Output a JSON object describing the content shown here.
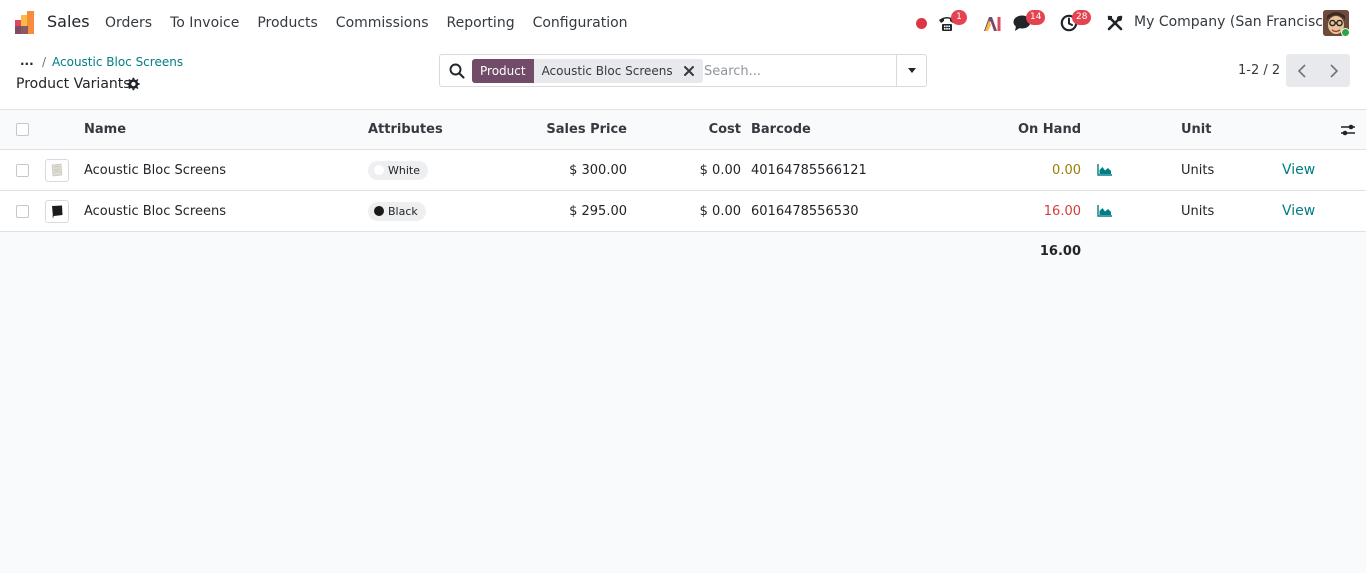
{
  "colors": {
    "brand": "#714b67",
    "link": "#017e84",
    "badge": "#e4434f",
    "stock_zero": "#9b7e08",
    "stock_positive": "#d23f3a"
  },
  "navbar": {
    "app_name": "Sales",
    "menu": [
      "Orders",
      "To Invoice",
      "Products",
      "Commissions",
      "Reporting",
      "Configuration"
    ],
    "badges": {
      "phone": "1",
      "messages": "14",
      "activities": "28"
    },
    "company": "My Company (San Francisco)",
    "icons": [
      "status-dot",
      "phone-icon",
      "ai-icon",
      "chat-icon",
      "clock-icon",
      "debug-tools-icon"
    ]
  },
  "breadcrumb": {
    "ellipsis": "...",
    "separator": "/",
    "parent": "Acoustic Bloc Screens",
    "current": "Product Variants"
  },
  "search": {
    "facet_label": "Product",
    "facet_value": "Acoustic Bloc Screens",
    "placeholder": "Search..."
  },
  "pager": {
    "value": "1-2 / 2"
  },
  "table": {
    "columns": {
      "name": "Name",
      "attributes": "Attributes",
      "sales_price": "Sales Price",
      "cost": "Cost",
      "barcode": "Barcode",
      "on_hand": "On Hand",
      "unit": "Unit"
    },
    "rows": [
      {
        "name": "Acoustic Bloc Screens",
        "attribute": "White",
        "attribute_color": "#ffffff",
        "sales_price": "$ 300.00",
        "cost": "$ 0.00",
        "barcode": "40164785566121",
        "on_hand": "0.00",
        "unit": "Units",
        "action": "View"
      },
      {
        "name": "Acoustic Bloc Screens",
        "attribute": "Black",
        "attribute_color": "#1a1a1a",
        "sales_price": "$ 295.00",
        "cost": "$ 0.00",
        "barcode": "6016478556530",
        "on_hand": "16.00",
        "unit": "Units",
        "action": "View"
      }
    ],
    "total_on_hand": "16.00"
  }
}
